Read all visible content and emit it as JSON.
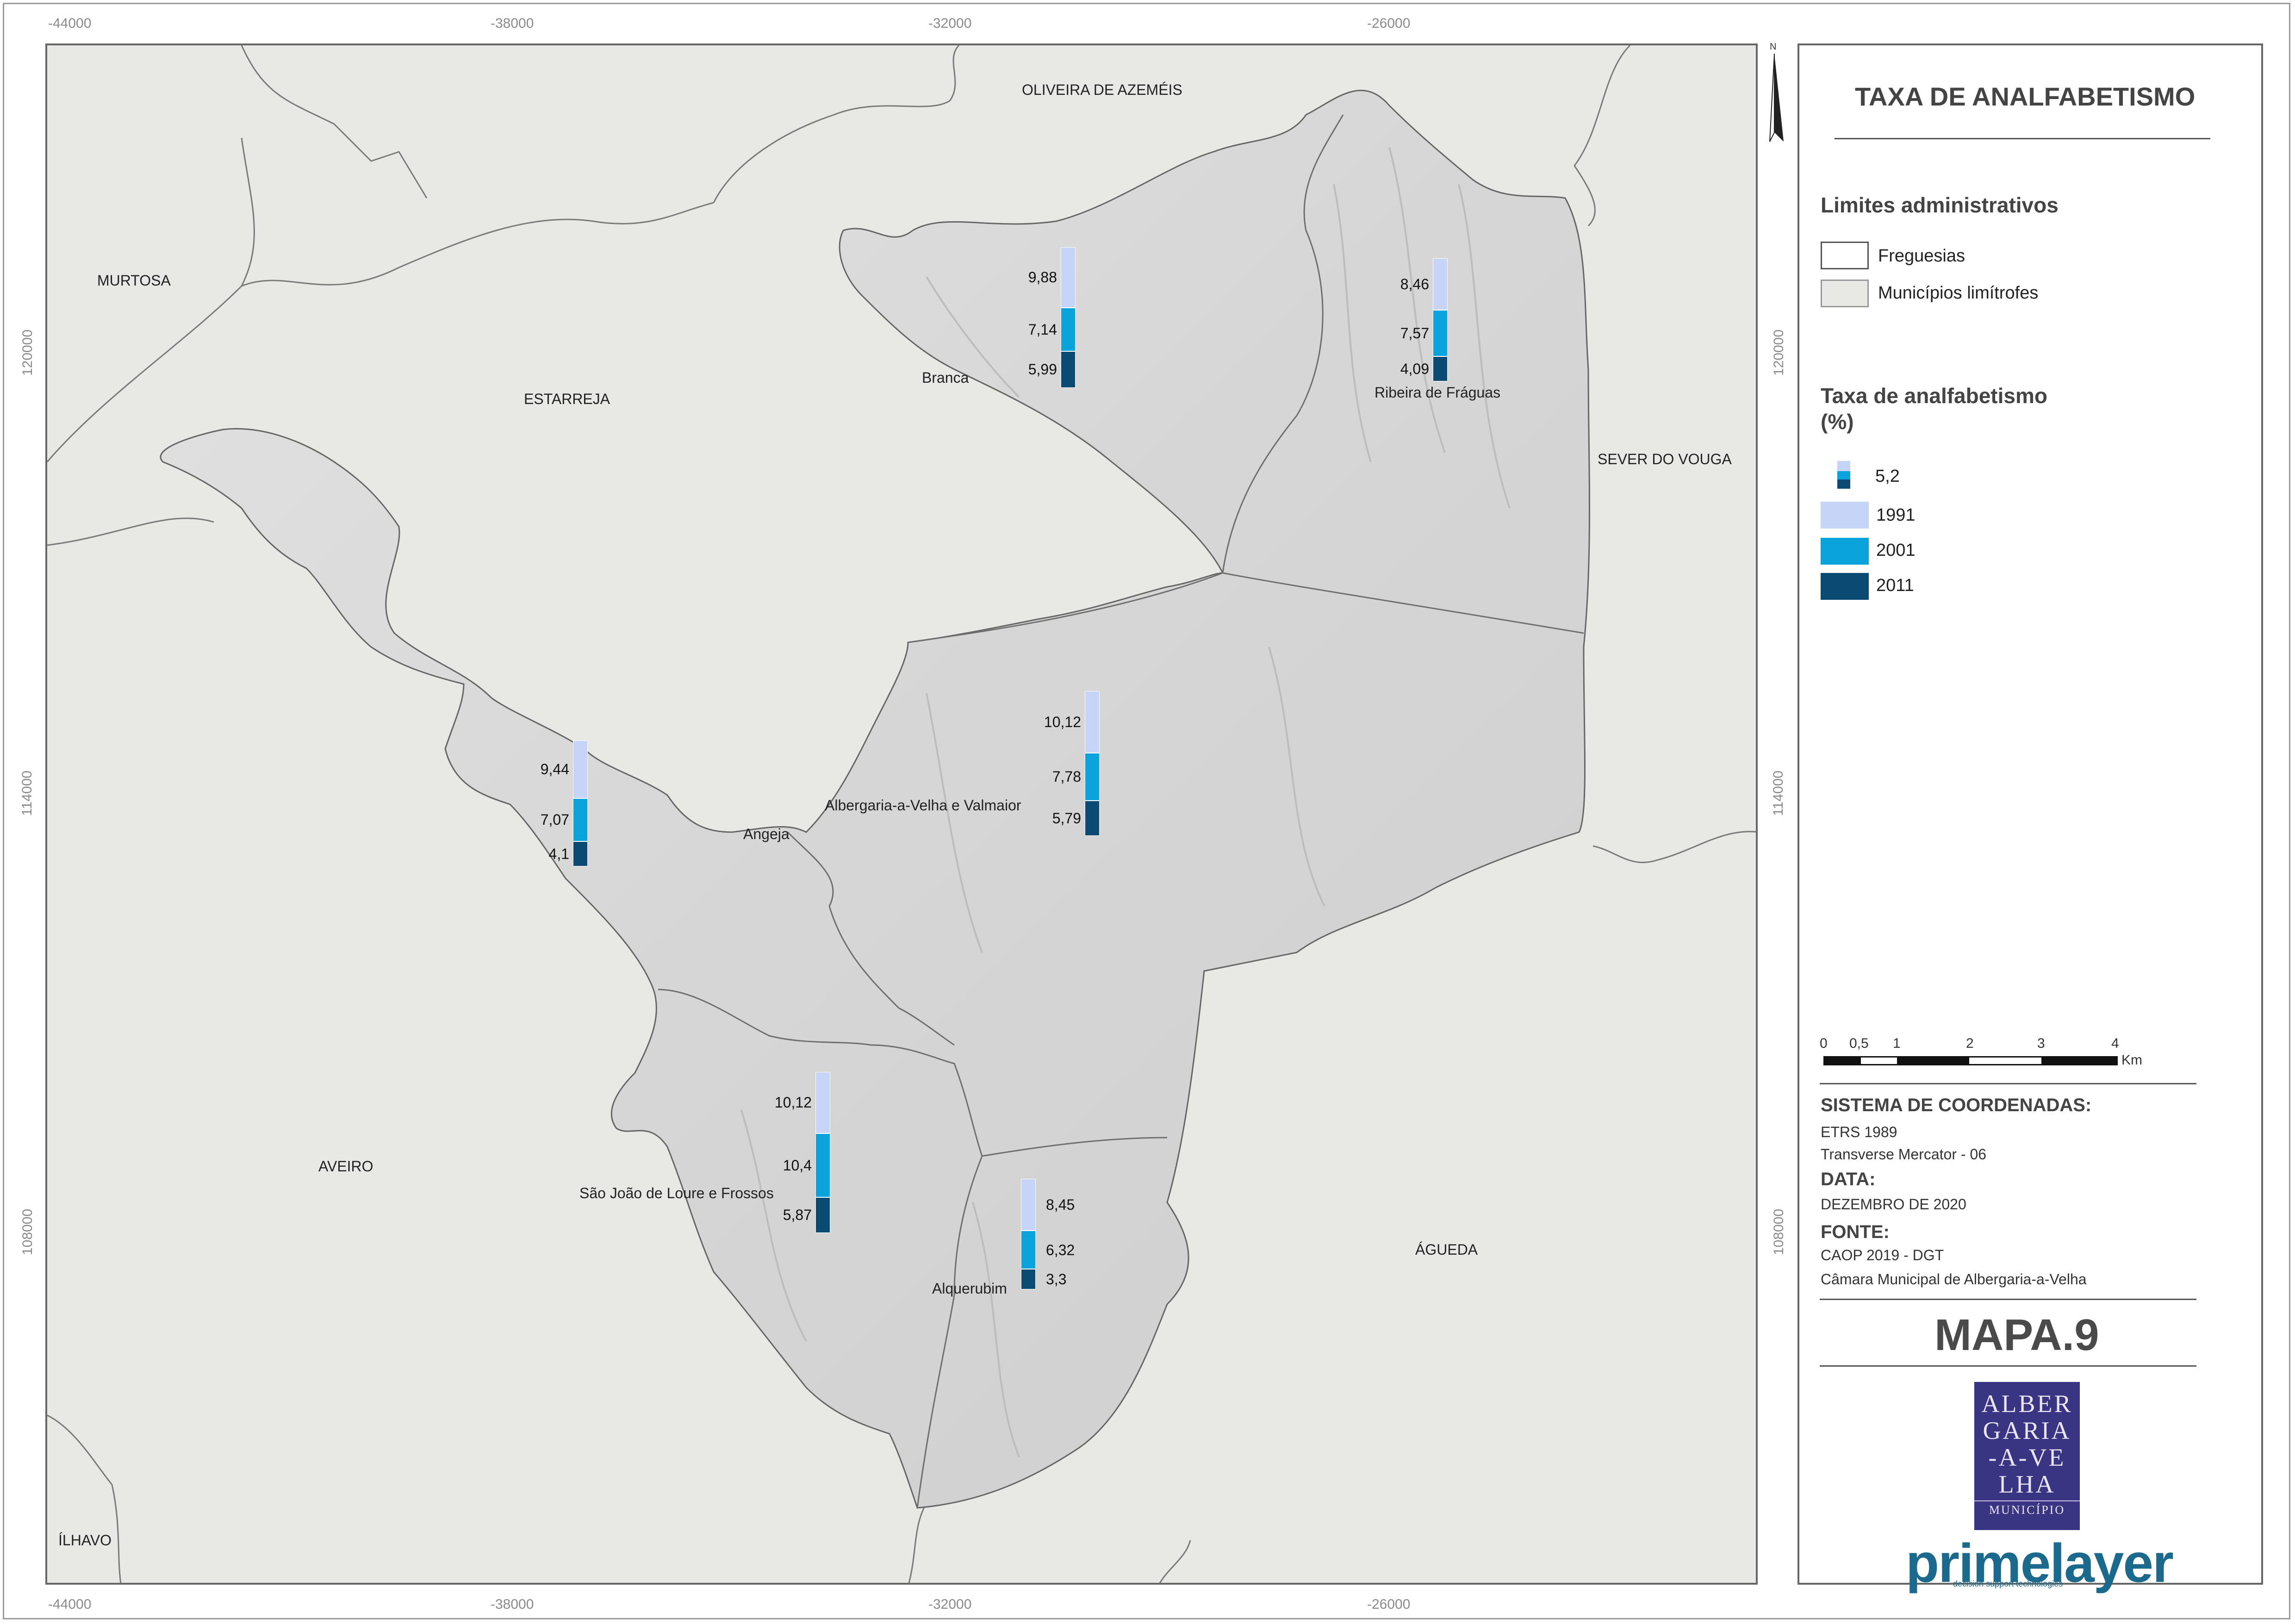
{
  "map": {
    "x_ticks": [
      "-44000",
      "-38000",
      "-32000",
      "-26000"
    ],
    "y_ticks": [
      "120000",
      "114000",
      "108000"
    ],
    "north_letter": "N",
    "places": [
      {
        "id": "oliveira",
        "label": "OLIVEIRA DE AZEMÉIS"
      },
      {
        "id": "murtosa",
        "label": "MURTOSA"
      },
      {
        "id": "estarreja",
        "label": "ESTARREJA"
      },
      {
        "id": "sever",
        "label": "SEVER DO VOUGA"
      },
      {
        "id": "aveiro",
        "label": "AVEIRO"
      },
      {
        "id": "agueda",
        "label": "ÁGUEDA"
      },
      {
        "id": "ilhavo",
        "label": "ÍLHAVO"
      }
    ],
    "parishes": [
      {
        "id": "branca",
        "label": "Branca"
      },
      {
        "id": "ribeira",
        "label": "Ribeira de Fráguas"
      },
      {
        "id": "angeja",
        "label": "Angeja"
      },
      {
        "id": "albergaria",
        "label": "Albergaria-a-Velha e Valmaior"
      },
      {
        "id": "sjoao",
        "label": "São João de Loure e Frossos"
      },
      {
        "id": "alquerubim",
        "label": "Alquerubim"
      }
    ],
    "bars": [
      {
        "id": "branca",
        "labels": [
          "9,88",
          "7,14",
          "5,99"
        ],
        "values": [
          9.88,
          7.14,
          5.99
        ]
      },
      {
        "id": "ribeira",
        "labels": [
          "8,46",
          "7,57",
          "4,09"
        ],
        "values": [
          8.46,
          7.57,
          4.09
        ]
      },
      {
        "id": "angeja",
        "labels": [
          "9,44",
          "7,07",
          "4,1"
        ],
        "values": [
          9.44,
          7.07,
          4.1
        ]
      },
      {
        "id": "albergaria",
        "labels": [
          "10,12",
          "7,78",
          "5,79"
        ],
        "values": [
          10.12,
          7.78,
          5.79
        ]
      },
      {
        "id": "sjoao",
        "labels": [
          "10,12",
          "10,4",
          "5,87"
        ],
        "values": [
          10.12,
          10.4,
          5.87
        ]
      },
      {
        "id": "alquerubim",
        "labels": [
          "8,45",
          "6,32",
          "3,3"
        ],
        "values": [
          8.45,
          6.32,
          3.3
        ]
      }
    ]
  },
  "legend": {
    "title": "TAXA DE ANALFABETISMO",
    "admin_heading": "Limites administrativos",
    "admin_items": [
      "Freguesias",
      "Municípios limítrofes"
    ],
    "rate_heading_1": "Taxa de analfabetismo",
    "rate_heading_2": "(%)",
    "sample_value": "5,2",
    "years": [
      "1991",
      "2001",
      "2011"
    ],
    "colors": {
      "y1991": "#c5d4f7",
      "y2001": "#0aa3dc",
      "y2011": "#0b4a73",
      "parish": "#d9d9d9",
      "outside": "#e8e9e5"
    },
    "scale_labels": [
      "0",
      "0,5",
      "1",
      "2",
      "3",
      "4"
    ],
    "scale_unit": "Km",
    "coord_heading": "SISTEMA DE COORDENADAS:",
    "coord_lines": [
      "ETRS 1989",
      "Transverse Mercator - 06"
    ],
    "date_heading": "DATA:",
    "date_value": "DEZEMBRO DE 2020",
    "source_heading": "FONTE:",
    "source_lines": [
      "CAOP 2019 - DGT",
      "Câmara Municipal de Albergaria-a-Velha"
    ],
    "map_number": "MAPA.9",
    "logo_lines": [
      "ALBER",
      "GARIA",
      "-A-VE",
      "LHA"
    ],
    "logo_sub": "MUNICÍPIO",
    "brand": "primelayer",
    "brand_sub": "decision support technologies"
  }
}
